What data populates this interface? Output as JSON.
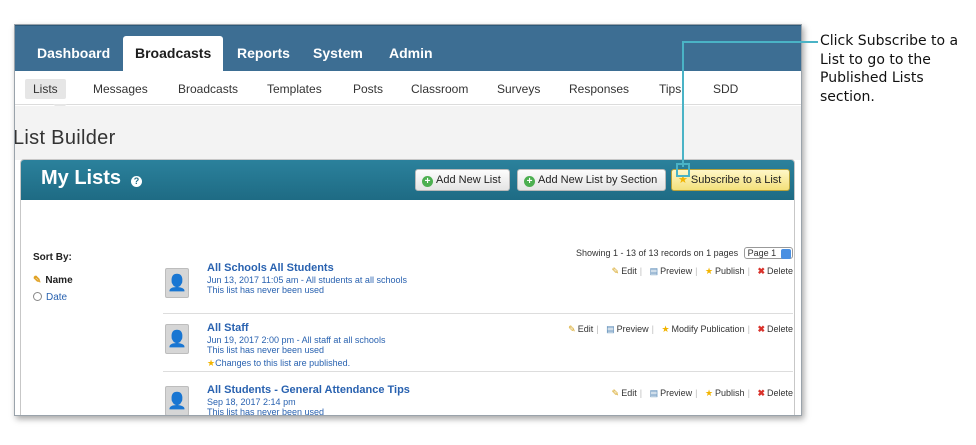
{
  "topnav": {
    "tabs": [
      {
        "label": "Dashboard",
        "active": false
      },
      {
        "label": "Broadcasts",
        "active": true
      },
      {
        "label": "Reports",
        "active": false
      },
      {
        "label": "System",
        "active": false
      },
      {
        "label": "Admin",
        "active": false
      }
    ]
  },
  "subnav": {
    "items": [
      {
        "label": "Lists",
        "active": true
      },
      {
        "label": "Messages"
      },
      {
        "label": "Broadcasts"
      },
      {
        "label": "Templates"
      },
      {
        "label": "Posts"
      },
      {
        "label": "Classroom"
      },
      {
        "label": "Surveys"
      },
      {
        "label": "Responses"
      },
      {
        "label": "Tips"
      },
      {
        "label": "SDD"
      }
    ]
  },
  "page_title": "List Builder",
  "panel": {
    "title": "My Lists",
    "help_icon": "?",
    "buttons": {
      "add_new": "Add New List",
      "add_by_section": "Add New List by Section",
      "subscribe": "Subscribe to a List"
    }
  },
  "sort": {
    "label": "Sort By:",
    "options": [
      "Name",
      "Date"
    ]
  },
  "pagination": {
    "showing": "Showing 1 - 13 of 13 records on 1 pages",
    "page": "Page 1"
  },
  "lists": [
    {
      "name": "All Schools All Students",
      "meta": "Jun 13, 2017 11:05 am - All students at all schools",
      "usage": "This list has never been used",
      "change_note": "",
      "actions": [
        "Edit",
        "Preview",
        "Publish",
        "Delete"
      ]
    },
    {
      "name": "All Staff",
      "meta": "Jun 19, 2017 2:00 pm - All staff at all schools",
      "usage": "This list has never been used",
      "change_note": "Changes to this list are published.",
      "actions": [
        "Edit",
        "Preview",
        "Modify Publication",
        "Delete"
      ]
    },
    {
      "name": "All Students - General Attendance Tips",
      "meta": "Sep 18, 2017 2:14 pm",
      "usage": "This list has never been used",
      "change_note": "",
      "actions": [
        "Edit",
        "Preview",
        "Publish",
        "Delete"
      ]
    }
  ],
  "callout": {
    "text": "Click Subscribe to a List to go to the Published Lists section."
  },
  "colors": {
    "nav_blue": "#3d6e93",
    "panel_teal": "#1e6b84",
    "link_blue": "#2962b0",
    "callout_line": "#4ab3c6"
  }
}
